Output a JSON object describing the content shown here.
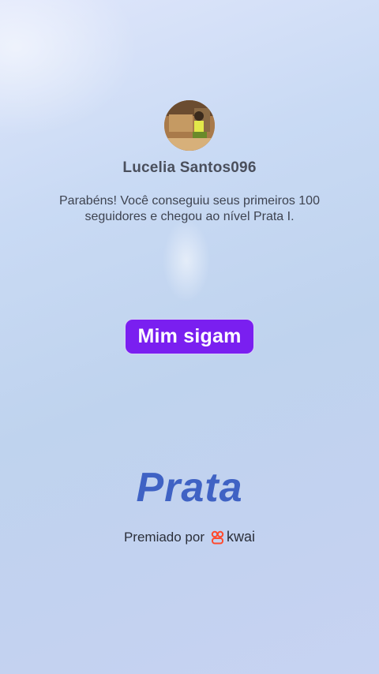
{
  "profile": {
    "username": "Lucelia Santos096"
  },
  "message": "Parabéns! Você conseguiu seus primeiros 100 seguidores e chegou ao nível Prata I.",
  "follow_button": {
    "label": "Mim sigam"
  },
  "level": {
    "title": "Prata"
  },
  "awarded_by": {
    "label": "Premiado por",
    "brand": "kwai",
    "brand_icon": "kwai-logo-icon",
    "brand_color": "#ff4a2d"
  },
  "colors": {
    "button": "#7a1ff0",
    "level_title": "#3f62c4"
  }
}
